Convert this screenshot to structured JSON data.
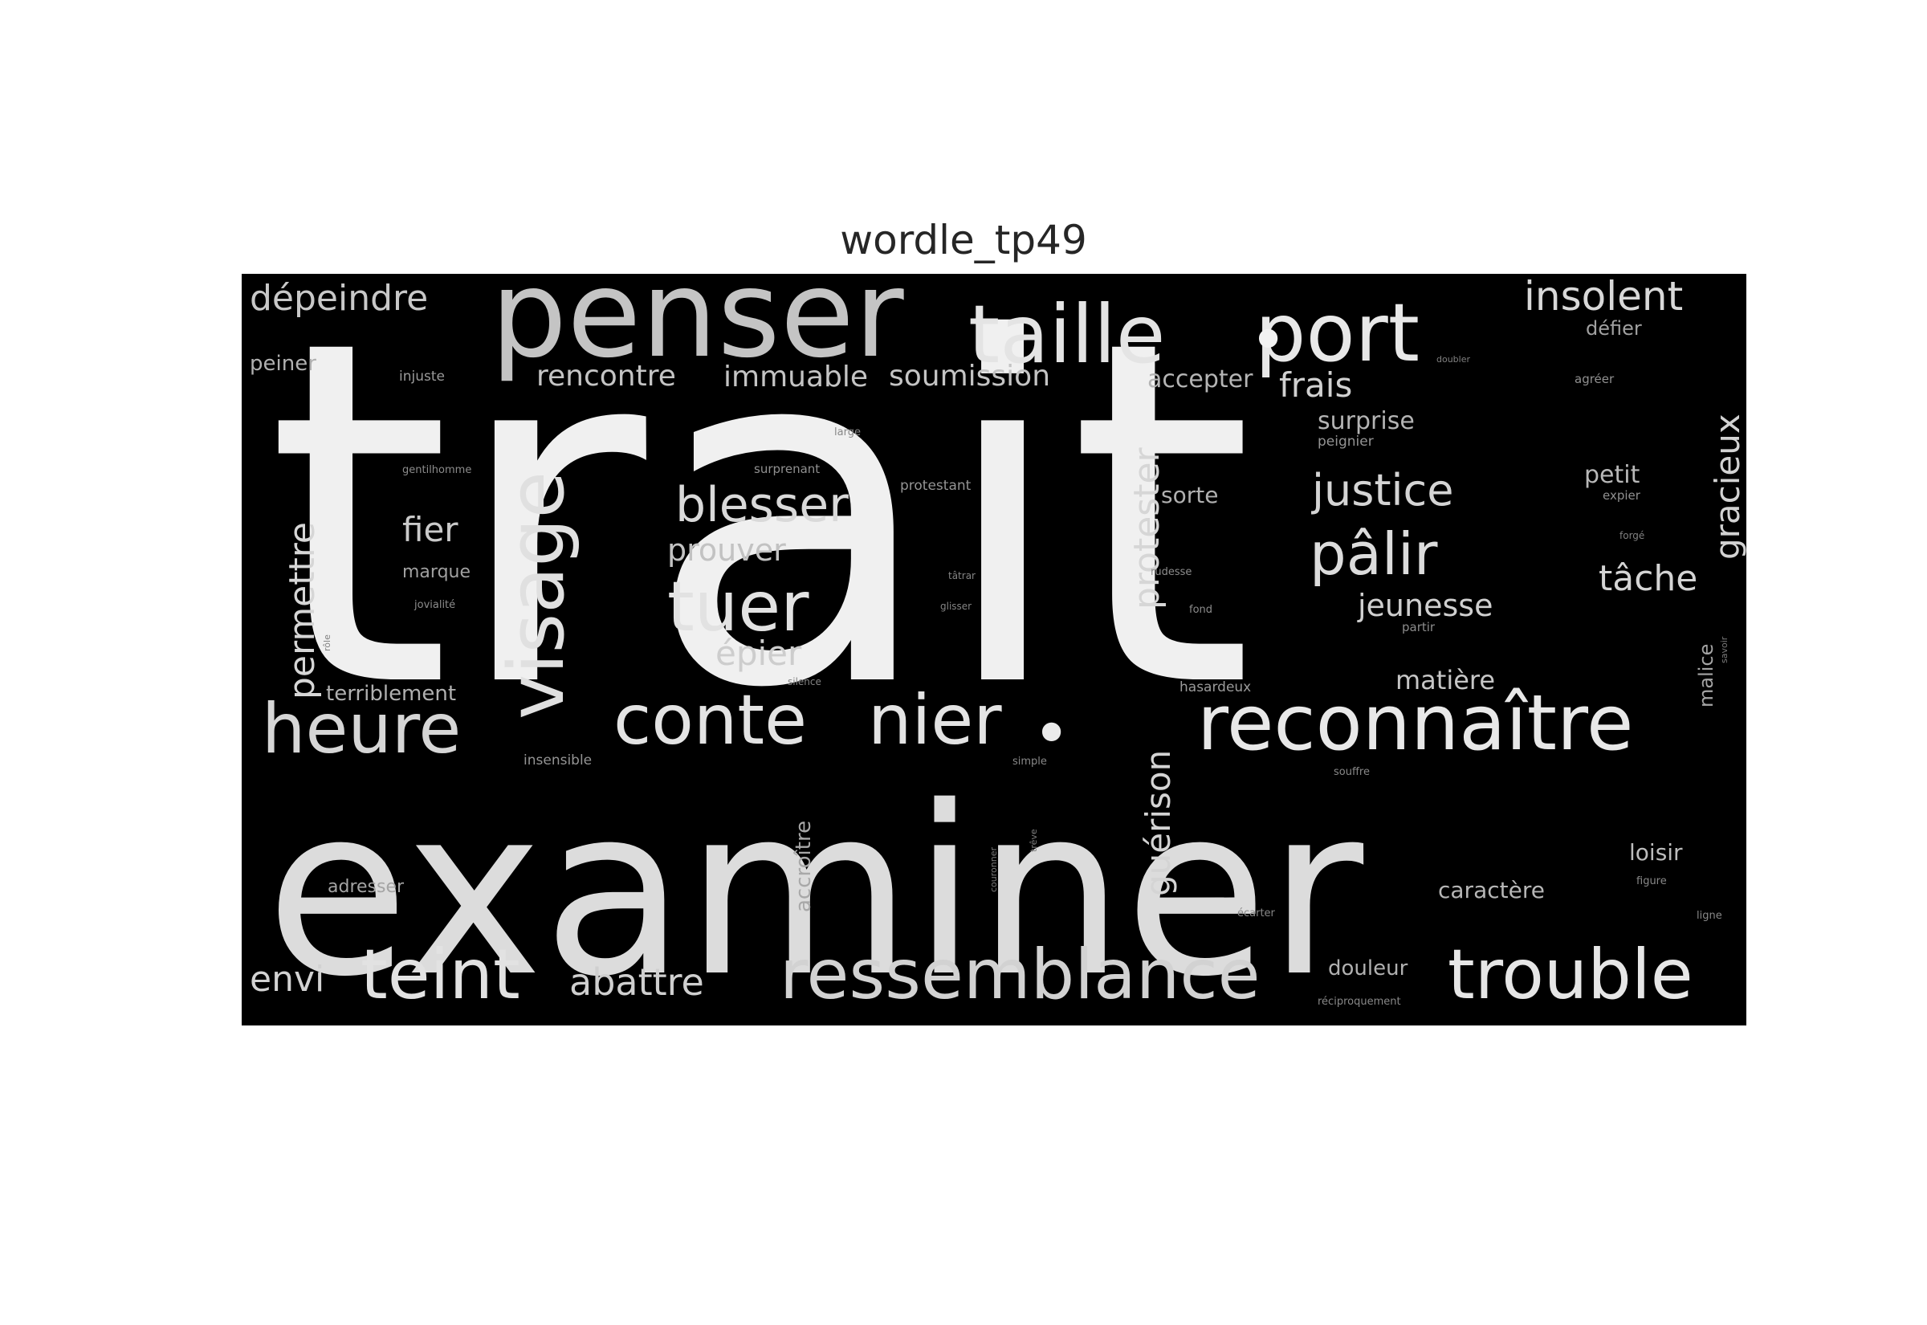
{
  "title": "wordle_tp49",
  "words": [
    {
      "text": "trait",
      "color": "#f0f0f0"
    },
    {
      "text": "examiner",
      "color": "#dcdcdc"
    },
    {
      "text": "penser",
      "color": "#c4c4c4"
    },
    {
      "text": "taille",
      "color": "#e4e4e4"
    },
    {
      "text": "port",
      "color": "#e8e8e8"
    },
    {
      "text": "•",
      "color": "#f2f2f2"
    },
    {
      "text": "•",
      "color": "#ebebeb"
    },
    {
      "text": "visage",
      "color": "#e0e0e0"
    },
    {
      "text": "reconnaître",
      "color": "#e8e8e8"
    },
    {
      "text": "ressemblance",
      "color": "#d2d2d2"
    },
    {
      "text": "trouble",
      "color": "#e6e6e6"
    },
    {
      "text": "teint",
      "color": "#e2e2e2"
    },
    {
      "text": "heure",
      "color": "#d6d6d6"
    },
    {
      "text": "conte",
      "color": "#e3e3e3"
    },
    {
      "text": "nier",
      "color": "#e3e3e3"
    },
    {
      "text": "tuer",
      "color": "#e2e2e2"
    },
    {
      "text": "pâlir",
      "color": "#dcdcdc"
    },
    {
      "text": "blesser",
      "color": "#d9d9d9"
    },
    {
      "text": "justice",
      "color": "#d4d4d4"
    },
    {
      "text": "insolent",
      "color": "#d8d8d8"
    },
    {
      "text": "dépeindre",
      "color": "#c8c8c8"
    },
    {
      "text": "abattre",
      "color": "#cfcfcf"
    },
    {
      "text": "envi",
      "color": "#d2d2d2"
    },
    {
      "text": "permettre",
      "color": "#d6d6d6"
    },
    {
      "text": "protester",
      "color": "#d6d6d6"
    },
    {
      "text": "gracieux",
      "color": "#d2d2d2"
    },
    {
      "text": "guérison",
      "color": "#d4d4d4"
    },
    {
      "text": "tâche",
      "color": "#d4d4d4"
    },
    {
      "text": "frais",
      "color": "#d0d0d0"
    },
    {
      "text": "jeunesse",
      "color": "#cfcfcf"
    },
    {
      "text": "épier",
      "color": "#cdcdcd"
    },
    {
      "text": "rencontre",
      "color": "#c4c4c4"
    },
    {
      "text": "immuable",
      "color": "#c4c4c4"
    },
    {
      "text": "soumission",
      "color": "#c4c4c4"
    },
    {
      "text": "fier",
      "color": "#cacaca"
    },
    {
      "text": "prouver",
      "color": "#c2c2c2"
    },
    {
      "text": "matière",
      "color": "#c6c6c6"
    },
    {
      "text": "surprise",
      "color": "#b4b4b4"
    },
    {
      "text": "accepter",
      "color": "#b4b4b4"
    },
    {
      "text": "terriblement",
      "color": "#b0b0b0"
    },
    {
      "text": "petit",
      "color": "#b8b8b8"
    },
    {
      "text": "sorte",
      "color": "#b0b0b0"
    },
    {
      "text": "peiner",
      "color": "#b0b0b0"
    },
    {
      "text": "loisir",
      "color": "#bcbcbc"
    },
    {
      "text": "caractère",
      "color": "#b6b6b6"
    },
    {
      "text": "douleur",
      "color": "#b0b0b0"
    },
    {
      "text": "accroître",
      "color": "#a8a8a8"
    },
    {
      "text": "adresser",
      "color": "#a4a4a4"
    },
    {
      "text": "malice",
      "color": "#a4a4a4"
    },
    {
      "text": "marque",
      "color": "#a0a0a0"
    },
    {
      "text": "défier",
      "color": "#a0a0a0"
    },
    {
      "text": "injuste",
      "color": "#9a9a9a"
    },
    {
      "text": "hasardeux",
      "color": "#9a9a9a"
    },
    {
      "text": "insensible",
      "color": "#949494"
    },
    {
      "text": "peignier",
      "color": "#949494"
    },
    {
      "text": "protestant",
      "color": "#949494"
    },
    {
      "text": "surprenant",
      "color": "#909090"
    },
    {
      "text": "agréer",
      "color": "#909090"
    },
    {
      "text": "expier",
      "color": "#909090"
    },
    {
      "text": "gentilhomme",
      "color": "#8c8c8c"
    },
    {
      "text": "jovialité",
      "color": "#8c8c8c"
    },
    {
      "text": "partir",
      "color": "#8c8c8c"
    },
    {
      "text": "rudesse",
      "color": "#8c8c8c"
    },
    {
      "text": "fond",
      "color": "#8c8c8c"
    },
    {
      "text": "large",
      "color": "#888888"
    },
    {
      "text": "figure",
      "color": "#888888"
    },
    {
      "text": "ligne",
      "color": "#888888"
    },
    {
      "text": "écarter",
      "color": "#888888"
    },
    {
      "text": "souffre",
      "color": "#888888"
    },
    {
      "text": "simple",
      "color": "#888888"
    },
    {
      "text": "réciproquement",
      "color": "#888888"
    },
    {
      "text": "silence",
      "color": "#848484"
    },
    {
      "text": "glisser",
      "color": "#848484"
    },
    {
      "text": "tâtrar",
      "color": "#848484"
    },
    {
      "text": "forgé",
      "color": "#808080"
    },
    {
      "text": "doubler",
      "color": "#808080"
    },
    {
      "text": "rôle",
      "color": "#808080"
    },
    {
      "text": "trêve",
      "color": "#808080"
    },
    {
      "text": "couronner",
      "color": "#7c7c7c"
    },
    {
      "text": "savoir",
      "color": "#7c7c7c"
    }
  ]
}
